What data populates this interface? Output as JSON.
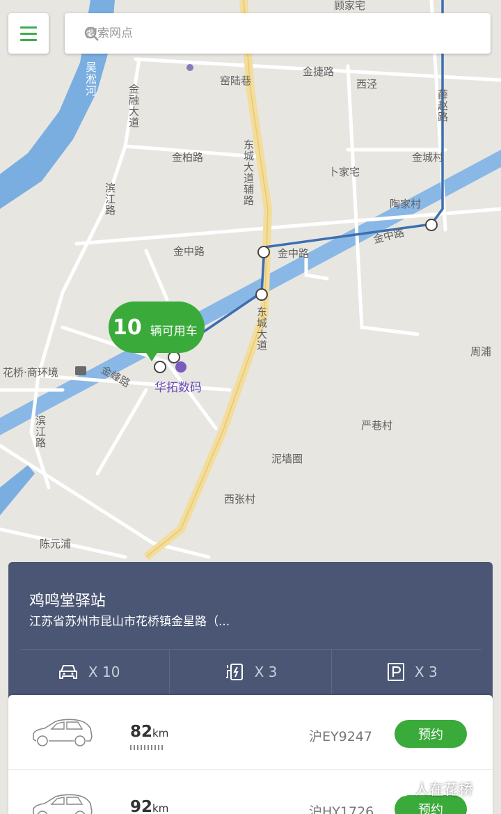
{
  "search": {
    "placeholder": "搜索网点"
  },
  "map": {
    "labels": {
      "wusong": "吴淞河",
      "jinrong": "金融大道",
      "jiaolu": "窑陆巷",
      "jinjie": "金捷路",
      "xijing": "西泾",
      "xuezhao": "薛赵路",
      "dongcheng_fu": "东城大道辅路",
      "jinbai": "金柏路",
      "jincheng": "金城村",
      "bujia": "卜家宅",
      "binjiang1": "滨江路",
      "taojia": "陶家村",
      "jinzhong1": "金中路",
      "jinzhong2": "金中路",
      "jinzhong3": "金中路",
      "dongcheng": "东城大道",
      "zhoupu": "周浦",
      "huaqiao": "花桥·商环境",
      "jinfeng": "金峰路",
      "huatuo": "华拓数码",
      "binjiang2": "滨江路",
      "yanxiang": "严巷村",
      "niqiang": "泥墙圈",
      "xizhang": "西张村",
      "chenyuan": "陈元浦",
      "gujia": "顾家宅"
    },
    "marker": {
      "count": "10",
      "text": "辆可用车"
    }
  },
  "station": {
    "name": "鸡鸣堂驿站",
    "address": "江苏省苏州市昆山市花桥镇金星路（...",
    "stats": [
      {
        "icon": "car-icon",
        "value": "X 10"
      },
      {
        "icon": "charger-icon",
        "value": "X 3"
      },
      {
        "icon": "parking-icon",
        "value": "X 3"
      }
    ]
  },
  "cars": [
    {
      "range": "82",
      "unit": "km",
      "plate": "沪EY9247",
      "action": "预约"
    },
    {
      "range": "92",
      "unit": "km",
      "plate": "沪HY1726",
      "action": "预约"
    }
  ],
  "watermark": "人在花桥",
  "colors": {
    "accent": "#3aaa3a",
    "panel": "#4b5675",
    "river": "#7aaee0",
    "route": "#3c6fb0"
  }
}
